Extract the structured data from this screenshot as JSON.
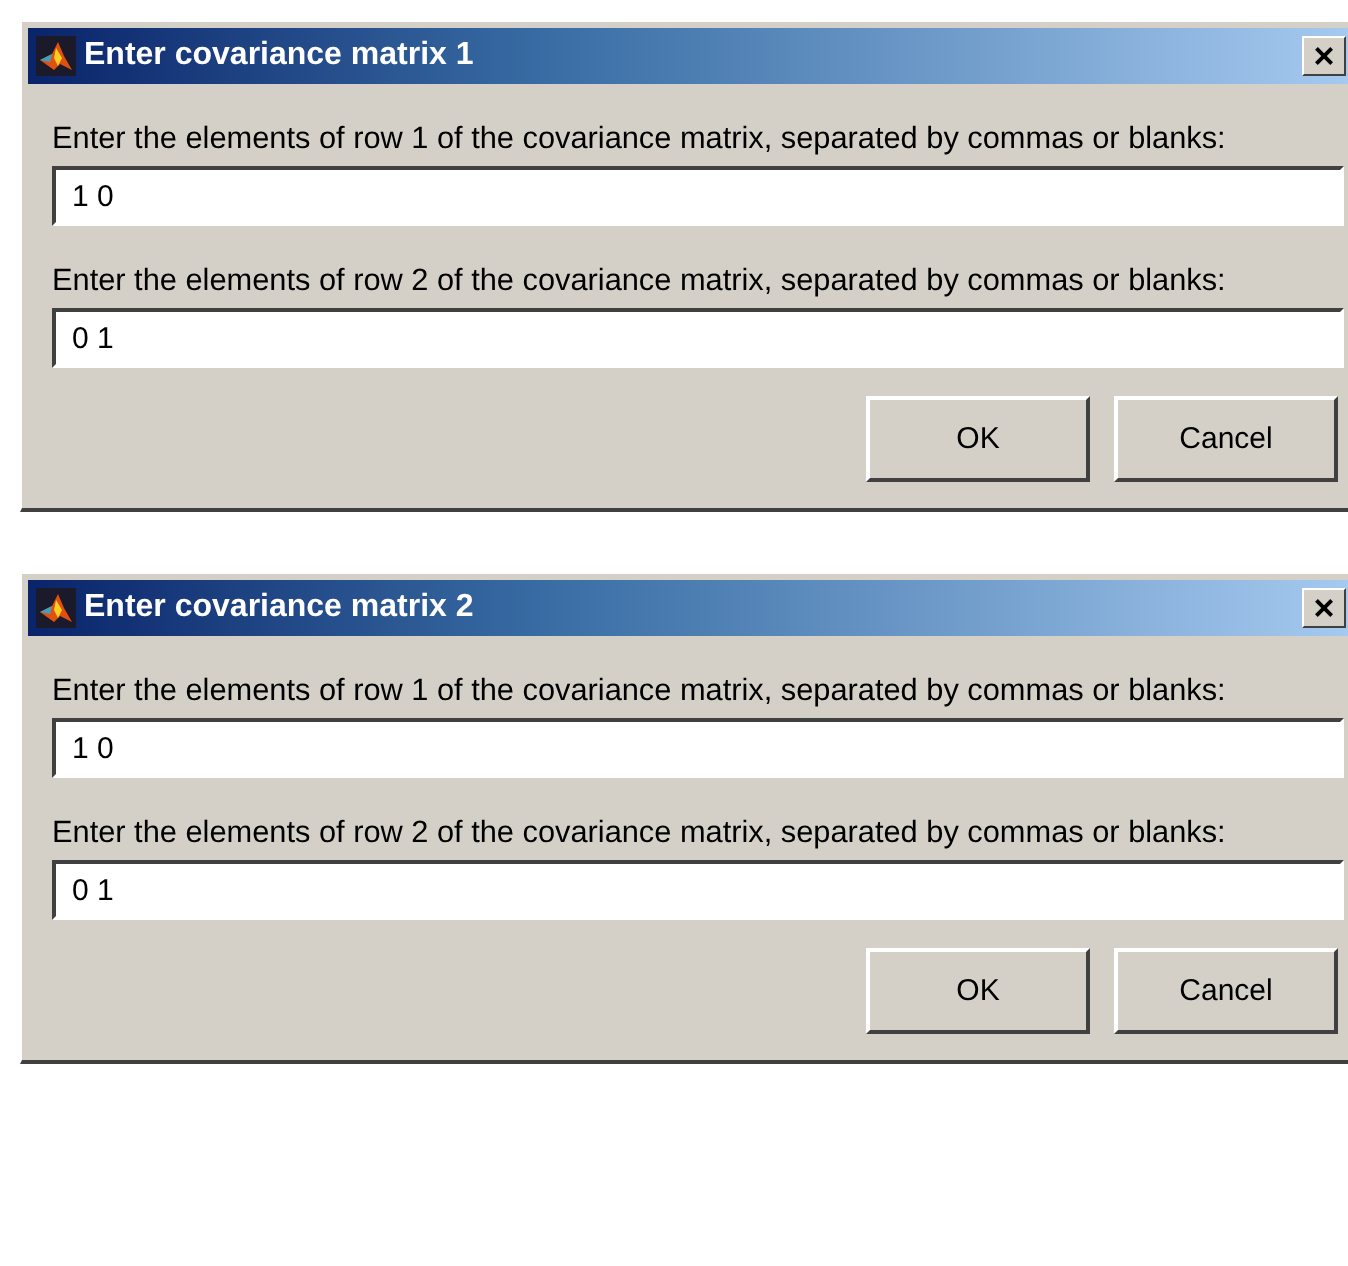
{
  "dialogs": [
    {
      "title": "Enter covariance matrix 1",
      "fields": [
        {
          "label": "Enter the elements of row 1 of the covariance matrix, separated by commas or blanks:",
          "value": "1 0"
        },
        {
          "label": "Enter the elements of row 2 of the covariance matrix, separated by commas or blanks:",
          "value": "0 1"
        }
      ],
      "close": "×",
      "buttons": [
        "OK",
        "Cancel"
      ]
    },
    {
      "title": "Enter covariance matrix 2",
      "fields": [
        {
          "label": "Enter the elements of row 1 of the covariance matrix, separated by commas or blanks:",
          "value": "1 0"
        },
        {
          "label": "Enter the elements of row 2 of the covariance matrix, separated by commas or blanks:",
          "value": "0 1"
        }
      ],
      "close": "×",
      "buttons": [
        "OK",
        "Cancel"
      ]
    }
  ]
}
